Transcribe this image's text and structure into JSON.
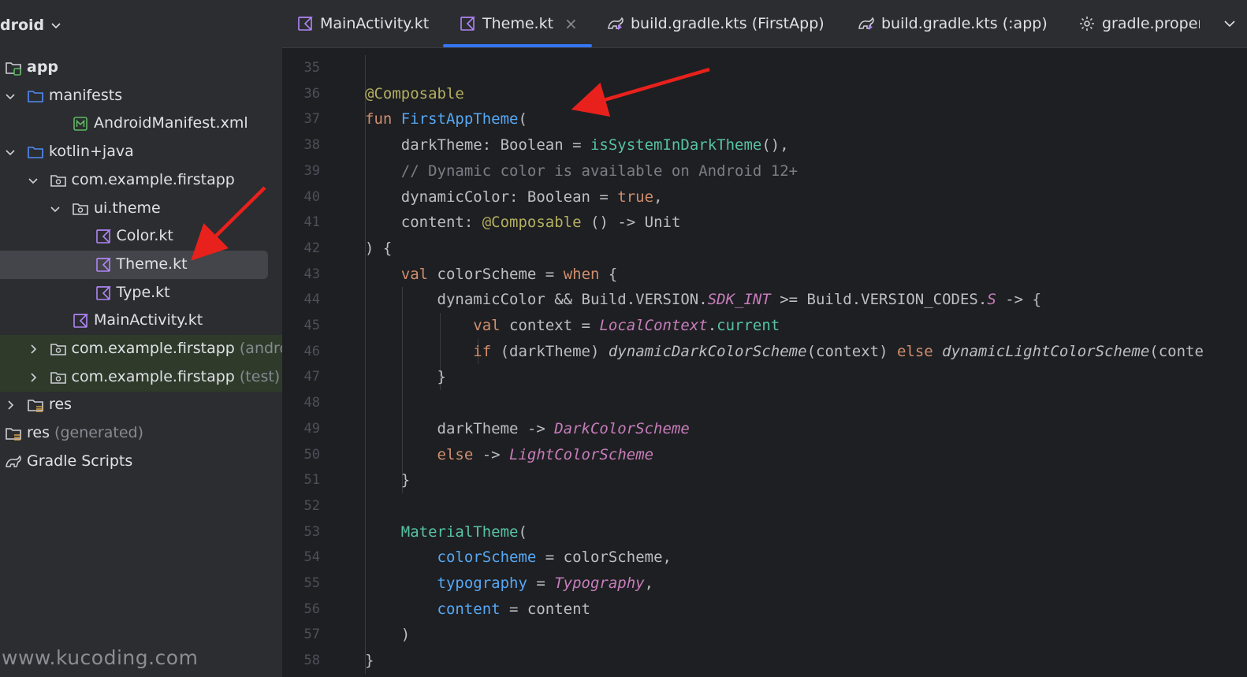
{
  "sidebar": {
    "header": "droid",
    "items": [
      {
        "label": "app",
        "muted": "",
        "icon": "module-folder-icon",
        "toggle": ""
      },
      {
        "label": "manifests",
        "muted": "",
        "icon": "folder-icon",
        "toggle": "expanded"
      },
      {
        "label": "AndroidManifest.xml",
        "muted": "",
        "icon": "manifest-file-icon",
        "toggle": ""
      },
      {
        "label": "kotlin+java",
        "muted": "",
        "icon": "folder-icon",
        "toggle": "expanded"
      },
      {
        "label": "com.example.firstapp",
        "muted": "",
        "icon": "package-icon",
        "toggle": "expanded"
      },
      {
        "label": "ui.theme",
        "muted": "",
        "icon": "package-icon",
        "toggle": "expanded"
      },
      {
        "label": "Color.kt",
        "muted": "",
        "icon": "kotlin-file-icon",
        "toggle": ""
      },
      {
        "label": "Theme.kt",
        "muted": "",
        "icon": "kotlin-file-icon",
        "toggle": ""
      },
      {
        "label": "Type.kt",
        "muted": "",
        "icon": "kotlin-file-icon",
        "toggle": ""
      },
      {
        "label": "MainActivity.kt",
        "muted": "",
        "icon": "kotlin-file-icon",
        "toggle": ""
      },
      {
        "label": "com.example.firstapp",
        "muted": "(androidT",
        "icon": "package-icon",
        "toggle": "collapsed"
      },
      {
        "label": "com.example.firstapp",
        "muted": "(test)",
        "icon": "package-icon",
        "toggle": "collapsed"
      },
      {
        "label": "res",
        "muted": "",
        "icon": "resource-folder-icon",
        "toggle": "collapsed"
      },
      {
        "label": "res",
        "muted": "(generated)",
        "icon": "resource-folder-icon",
        "toggle": ""
      },
      {
        "label": "Gradle Scripts",
        "muted": "",
        "icon": "gradle-icon",
        "toggle": ""
      }
    ],
    "watermark": "www.kucoding.com"
  },
  "tabs": [
    {
      "label": "MainActivity.kt",
      "icon": "kotlin-file-icon",
      "active": false
    },
    {
      "label": "Theme.kt",
      "icon": "kotlin-file-icon",
      "active": true,
      "close": "×"
    },
    {
      "label": "build.gradle.kts (FirstApp)",
      "icon": "gradle-kts-icon",
      "active": false
    },
    {
      "label": "build.gradle.kts (:app)",
      "icon": "gradle-kts-icon",
      "active": false
    },
    {
      "label": "gradle.propert",
      "icon": "gear-icon",
      "active": false
    }
  ],
  "editor": {
    "line_numbers": [
      "35",
      "36",
      "37",
      "38",
      "39",
      "40",
      "41",
      "42",
      "43",
      "44",
      "45",
      "46",
      "47",
      "48",
      "49",
      "50",
      "51",
      "52",
      "53",
      "54",
      "55",
      "56",
      "57",
      "58"
    ],
    "lines": [
      [],
      [
        {
          "t": "@Composable",
          "c": "ann"
        }
      ],
      [
        {
          "t": "fun ",
          "c": "kw"
        },
        {
          "t": "FirstAppTheme",
          "c": "fn"
        },
        {
          "t": "(",
          "c": ""
        }
      ],
      [
        {
          "t": "    darkTheme: Boolean = ",
          "c": ""
        },
        {
          "t": "isSystemInDarkTheme",
          "c": "compose"
        },
        {
          "t": "(),",
          "c": ""
        }
      ],
      [
        {
          "t": "    // Dynamic color is available on Android 12+",
          "c": "cmt"
        }
      ],
      [
        {
          "t": "    dynamicColor: Boolean = ",
          "c": ""
        },
        {
          "t": "true",
          "c": "kw"
        },
        {
          "t": ",",
          "c": ""
        }
      ],
      [
        {
          "t": "    content: ",
          "c": ""
        },
        {
          "t": "@Composable",
          "c": "ann"
        },
        {
          "t": " () -> Unit",
          "c": ""
        }
      ],
      [
        {
          "t": ") {",
          "c": ""
        }
      ],
      [
        {
          "t": "    ",
          "c": ""
        },
        {
          "t": "val ",
          "c": "kw"
        },
        {
          "t": "colorScheme = ",
          "c": ""
        },
        {
          "t": "when",
          "c": "kw"
        },
        {
          "t": " {",
          "c": ""
        }
      ],
      [
        {
          "t": "        dynamicColor && Build.VERSION.",
          "c": ""
        },
        {
          "t": "SDK_INT",
          "c": "italic-purple"
        },
        {
          "t": " >= Build.VERSION_CODES.",
          "c": ""
        },
        {
          "t": "S",
          "c": "italic-purple"
        },
        {
          "t": " -> {",
          "c": ""
        }
      ],
      [
        {
          "t": "            ",
          "c": ""
        },
        {
          "t": "val ",
          "c": "kw"
        },
        {
          "t": "context = ",
          "c": ""
        },
        {
          "t": "LocalContext",
          "c": "italic-purple"
        },
        {
          "t": ".",
          "c": ""
        },
        {
          "t": "current",
          "c": "compose"
        }
      ],
      [
        {
          "t": "            ",
          "c": ""
        },
        {
          "t": "if ",
          "c": "kw"
        },
        {
          "t": "(darkTheme) ",
          "c": ""
        },
        {
          "t": "dynamicDarkColorScheme",
          "c": "ital"
        },
        {
          "t": "(context) ",
          "c": ""
        },
        {
          "t": "else ",
          "c": "kw"
        },
        {
          "t": "dynamicLightColorScheme",
          "c": "ital"
        },
        {
          "t": "(conte",
          "c": ""
        }
      ],
      [
        {
          "t": "        }",
          "c": ""
        }
      ],
      [],
      [
        {
          "t": "        darkTheme -> ",
          "c": ""
        },
        {
          "t": "DarkColorScheme",
          "c": "italic-purple"
        }
      ],
      [
        {
          "t": "        ",
          "c": ""
        },
        {
          "t": "else",
          "c": "kw"
        },
        {
          "t": " -> ",
          "c": ""
        },
        {
          "t": "LightColorScheme",
          "c": "italic-purple"
        }
      ],
      [
        {
          "t": "    }",
          "c": ""
        }
      ],
      [],
      [
        {
          "t": "    ",
          "c": ""
        },
        {
          "t": "MaterialTheme",
          "c": "compose"
        },
        {
          "t": "(",
          "c": ""
        }
      ],
      [
        {
          "t": "        ",
          "c": ""
        },
        {
          "t": "colorScheme",
          "c": "param"
        },
        {
          "t": " = colorScheme,",
          "c": ""
        }
      ],
      [
        {
          "t": "        ",
          "c": ""
        },
        {
          "t": "typography",
          "c": "param"
        },
        {
          "t": " = ",
          "c": ""
        },
        {
          "t": "Typography",
          "c": "italic-purple"
        },
        {
          "t": ",",
          "c": ""
        }
      ],
      [
        {
          "t": "        ",
          "c": ""
        },
        {
          "t": "content",
          "c": "param"
        },
        {
          "t": " = content",
          "c": ""
        }
      ],
      [
        {
          "t": "    )",
          "c": ""
        }
      ],
      [
        {
          "t": "}",
          "c": ""
        }
      ]
    ]
  },
  "colors": {
    "accent": "#3574f0",
    "annotation_arrow": "#e8211c",
    "selected_row": "#43454a"
  }
}
